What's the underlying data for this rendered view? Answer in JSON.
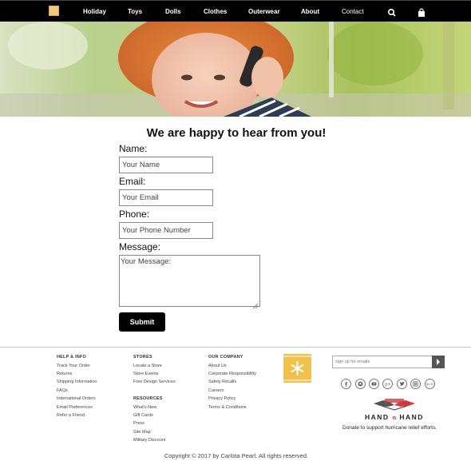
{
  "nav": {
    "items": [
      "Holiday",
      "Toys",
      "Dolls",
      "Clothes",
      "Outerwear",
      "About",
      "Contact"
    ],
    "search_icon": "search-icon",
    "bag_icon": "shopping-bag-icon"
  },
  "hero": {
    "description_icon": "hero-image-child-on-phone"
  },
  "form": {
    "title": "We are happy to hear from you!",
    "name_label": "Name:",
    "name_placeholder": "Your Name",
    "email_label": "Email:",
    "email_placeholder": "Your Email",
    "phone_label": "Phone:",
    "phone_placeholder": "Your Phone Number",
    "message_label": "Message:",
    "message_placeholder": "Your Message:",
    "submit_label": "Submit"
  },
  "footer": {
    "help": {
      "heading": "HELP & INFO",
      "links": [
        "Track Your Order",
        "Returns",
        "Shipping Information",
        "FAQs",
        "International Orders",
        "Email Preferences",
        "Refer a Friend"
      ]
    },
    "stores": {
      "heading": "STORES",
      "links": [
        "Locate a Store",
        "Store Events",
        "Free Design Services"
      ]
    },
    "resources": {
      "heading": "RESOURCES",
      "links": [
        "What's New",
        "Gift Cards",
        "Press",
        "Site Map",
        "Military Discount"
      ]
    },
    "company": {
      "heading": "OUR COMPANY",
      "links": [
        "About Us",
        "Corporate Responsibility",
        "Safety Recalls",
        "Careers",
        "Privacy Policy",
        "Terms & Conditions"
      ]
    },
    "email_placeholder": "sign up for emails",
    "social_icons": [
      "facebook-icon",
      "pinterest-icon",
      "youtube-icon",
      "google-plus-icon",
      "twitter-icon",
      "instagram-icon",
      "blog-icon"
    ],
    "hih_brand": {
      "left": "HAND",
      "mid": "IN",
      "right": "HAND"
    },
    "donate_text": "Donate to support hurricane relief efforts.",
    "copyright": "Copyright © 2017 by Carlota Pearl. All rights reserved."
  },
  "colors": {
    "nav_bg": "#000000",
    "accent_yellow": "#f1c24b",
    "button_bg": "#000000"
  }
}
